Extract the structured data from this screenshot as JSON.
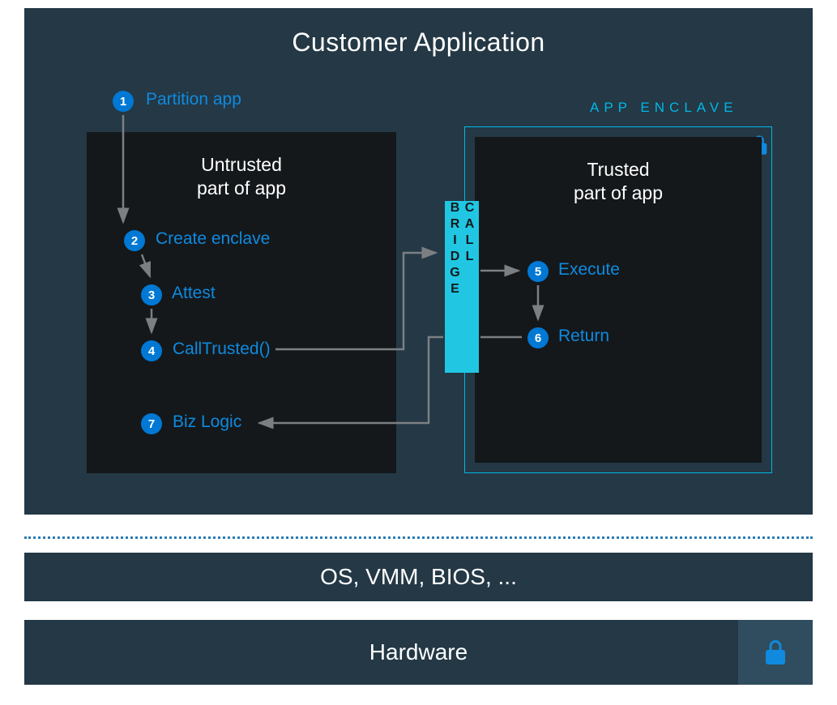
{
  "title": "Customer Application",
  "steps": {
    "s1": {
      "num": "1",
      "label": "Partition app"
    },
    "s2": {
      "num": "2",
      "label": "Create enclave"
    },
    "s3": {
      "num": "3",
      "label": "Attest"
    },
    "s4": {
      "num": "4",
      "label": "CallTrusted()"
    },
    "s5": {
      "num": "5",
      "label": "Execute"
    },
    "s6": {
      "num": "6",
      "label": "Return"
    },
    "s7": {
      "num": "7",
      "label": "Biz Logic"
    }
  },
  "untrusted_title_line1": "Untrusted",
  "untrusted_title_line2": "part of app",
  "trusted_title_line1": "Trusted",
  "trusted_title_line2": "part of app",
  "enclave_label": "APP ENCLAVE",
  "call_bridge": "CALL BRIDGE",
  "os_bar": "OS, VMM, BIOS, ...",
  "hardware_bar": "Hardware",
  "colors": {
    "panel_bg": "#243845",
    "box_bg": "#14181b",
    "accent_blue": "#0078d4",
    "link_blue": "#0f8adf",
    "cyan": "#00b8e6",
    "bridge": "#21c6e2"
  }
}
